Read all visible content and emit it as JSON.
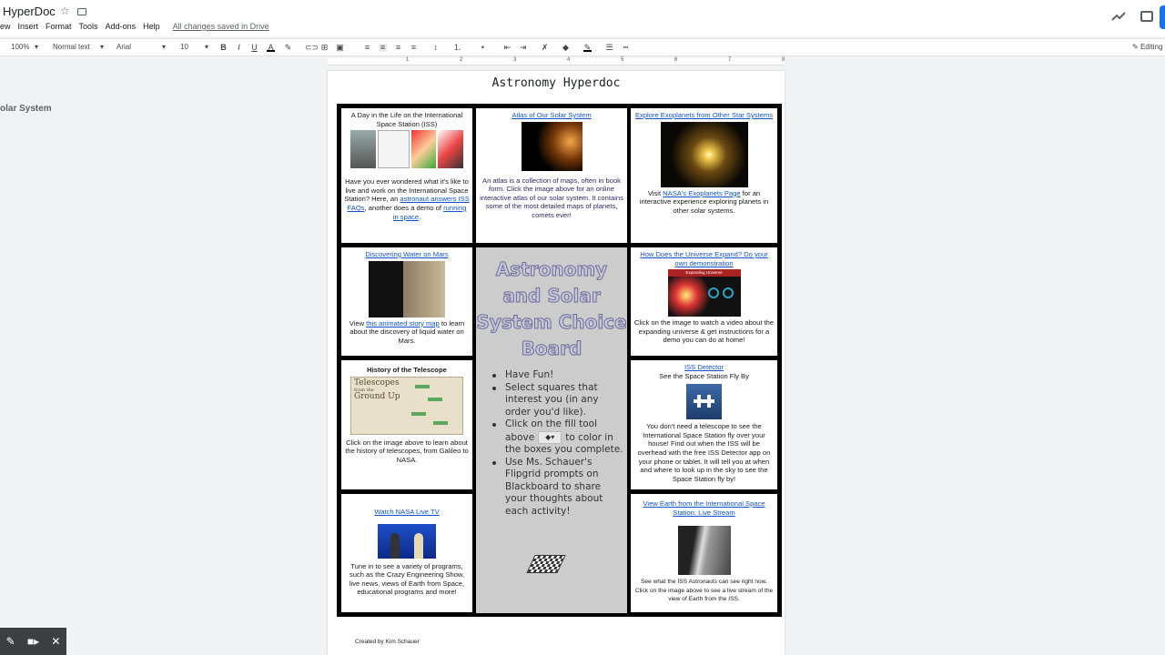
{
  "app": {
    "doc_title": "HyperDoc",
    "menu": [
      "ew",
      "Insert",
      "Format",
      "Tools",
      "Add-ons",
      "Help"
    ],
    "save_status": "All changes saved in Drive",
    "editing_label": "Editing"
  },
  "toolbar": {
    "zoom": "100%",
    "style": "Normal text",
    "font": "Arial",
    "font_size": "10"
  },
  "ruler": [
    "1",
    "2",
    "3",
    "4",
    "5",
    "6",
    "7",
    "8"
  ],
  "outline": {
    "item": "olar System"
  },
  "document": {
    "title": "Astronomy Hyperdoc",
    "footer": "Created by Kim Schauer"
  },
  "cells": {
    "iss_day": {
      "title": "A Day in the Life on the International Space Station (ISS)",
      "text1": "Have you ever wondered what it's like to live and work on the International Space Station? Here, an ",
      "link1": "astronaut answers ISS FAQs",
      "text2": ", another does a demo of ",
      "link2": "running in space",
      "text3": "."
    },
    "atlas": {
      "title": "Atlas of Our Solar System",
      "text": "An atlas is a collection of maps, often in book form. Click the image above for an online interactive atlas of our solar system.  It contains some of the most detailed maps of planets, comets ever!"
    },
    "exoplanets": {
      "title": "Explore Exoplanets from Other Star Systems",
      "text1": "Visit ",
      "link": "NASA's Exoplanets Page",
      "text2": " for an interactive experience exploring planets in other solar systems."
    },
    "mars": {
      "title": "Discovering Water on Mars",
      "text1": "View ",
      "link": "this animated story map",
      "text2": " to learn about the discovery of liquid water on Mars."
    },
    "universe": {
      "title": "How Does the Universe Expand?  Do your own demonstration",
      "img_caption": "Expanding Universe",
      "text": "Click on the image to watch a video about the expanding universe & get instructions for a demo you can do at home!"
    },
    "telescope": {
      "title": "History of the Telescope",
      "img_caption1": "Telescopes",
      "img_caption2": "from the",
      "img_caption3": "Ground Up",
      "text": "Click on the image above to learn about the history of telescopes, from Galileo to NASA."
    },
    "iss_detector": {
      "title": "ISS Detector",
      "subtitle": "See the Space Station Fly By",
      "text": "You don't need a telescope to see the International Space Station fly over your house! Find out when the ISS will be overhead with the free ISS Detector app on your phone or tablet.  It will tell you at when and where to look up in the sky to see the Space Station fly by!"
    },
    "nasa_tv": {
      "title": "Watch NASA Live TV",
      "text": "Tune in to see a variety of programs, such as the Crazy Engineering Show, live news, views of Earth from Space, educational programs and more!"
    },
    "earth_view": {
      "title": "View Earth from the International Space Station: Live Stream",
      "text": "See what the ISS Astronauts can see right now. Click on the image above to see a live stream of the view of Earth from the ISS."
    }
  },
  "choice_board": {
    "title": "Astronomy and Solar System Choice Board",
    "items": [
      "Have Fun!",
      "Select squares that interest you (in any order you'd like).",
      "Click on the fill tool above",
      "to color in the boxes you complete.",
      "Use Ms. Schauer's Flipgrid prompts on Blackboard to share your thoughts about each activity!"
    ]
  },
  "colors": {
    "link": "#1155cc",
    "board_bg": "#000000",
    "center_bg": "#cccccc",
    "accent": "#1a73e8"
  }
}
